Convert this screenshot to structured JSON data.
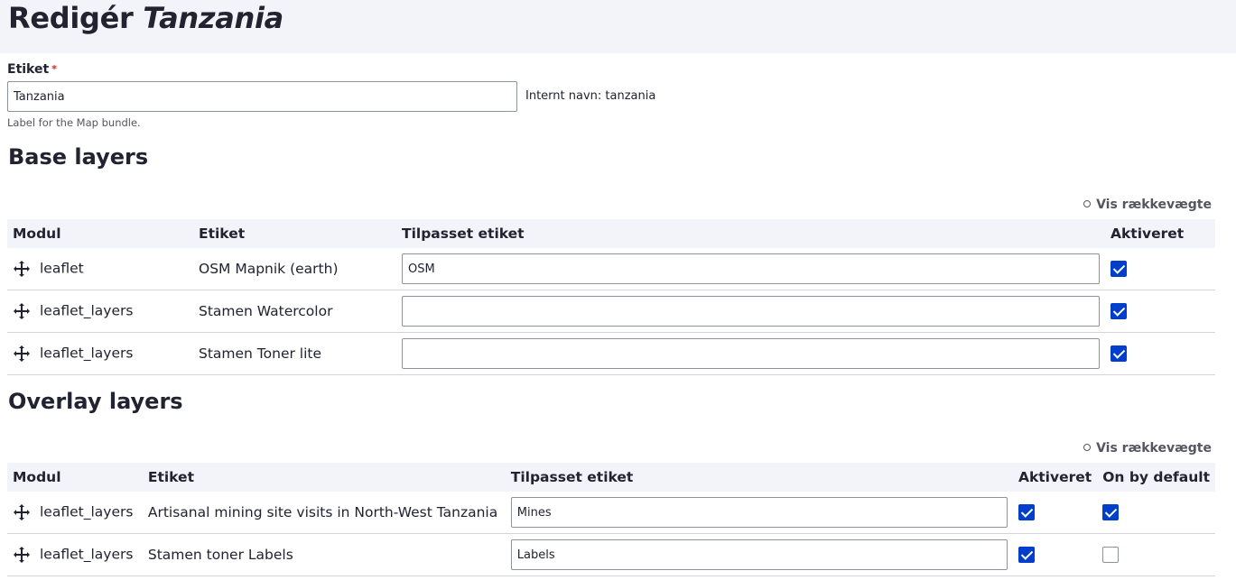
{
  "page": {
    "title_prefix": "Redigér",
    "title_emph": "Tanzania"
  },
  "label_field": {
    "label": "Etiket",
    "required_marker": "*",
    "value": "Tanzania",
    "machine_name_text": "Internt navn: tanzania",
    "description": "Label for the Map bundle."
  },
  "base_layers": {
    "heading": "Base layers",
    "show_weights": "Vis rækkevægte",
    "columns": [
      "Modul",
      "Etiket",
      "Tilpasset etiket",
      "Aktiveret"
    ],
    "rows": [
      {
        "module": "leaflet",
        "label": "OSM Mapnik (earth)",
        "custom_label": "OSM",
        "enabled": true
      },
      {
        "module": "leaflet_layers",
        "label": "Stamen Watercolor",
        "custom_label": "",
        "enabled": true
      },
      {
        "module": "leaflet_layers",
        "label": "Stamen Toner lite",
        "custom_label": "",
        "enabled": true
      }
    ]
  },
  "overlay_layers": {
    "heading": "Overlay layers",
    "show_weights": "Vis rækkevægte",
    "columns": [
      "Modul",
      "Etiket",
      "Tilpasset etiket",
      "Aktiveret",
      "On by default"
    ],
    "rows": [
      {
        "module": "leaflet_layers",
        "label": "Artisanal mining site visits in North-West Tanzania",
        "custom_label": "Mines",
        "enabled": true,
        "on_by_default": true
      },
      {
        "module": "leaflet_layers",
        "label": "Stamen toner Labels",
        "custom_label": "Labels",
        "enabled": true,
        "on_by_default": false
      }
    ]
  },
  "colors": {
    "accent": "#003ecc",
    "header_bg": "#f3f4f9",
    "required": "#dc2323"
  },
  "icons": {
    "drag_handle": "move-arrows-icon",
    "checkbox": "checkbox-icon"
  }
}
